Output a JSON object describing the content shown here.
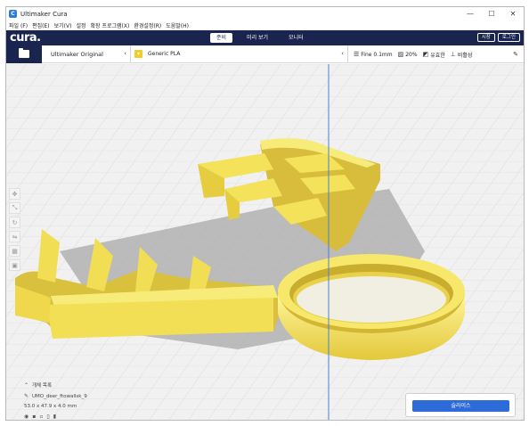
{
  "window": {
    "title": "Ultimaker Cura",
    "app_icon": "cura-app-icon",
    "controls": {
      "minimize": "—",
      "maximize": "☐",
      "close": "✕"
    }
  },
  "menu": [
    "파일 (F)",
    "편집(E)",
    "보기(V)",
    "설정",
    "확장 프로그램(X)",
    "환경설정(R)",
    "도움말(H)"
  ],
  "header": {
    "logo": "cura.",
    "stages": [
      {
        "label": "준비",
        "active": true
      },
      {
        "label": "미리 보기",
        "active": false
      },
      {
        "label": "모니터",
        "active": false
      }
    ],
    "right_buttons": [
      "시장",
      "로그인"
    ]
  },
  "toolbar": {
    "open_icon": "folder-icon",
    "printer": "Ultimaker Original",
    "material": "Generic PLA",
    "settings": {
      "profile": "Fine 0.1mm",
      "infill": "20%",
      "support": "유효한",
      "adhesion": "비활성"
    }
  },
  "left_tools": [
    "move-tool-icon",
    "scale-tool-icon",
    "rotate-tool-icon",
    "mirror-tool-icon",
    "per-model-settings-icon",
    "support-blocker-icon"
  ],
  "object": {
    "list_label": "개체 목록",
    "name": "UMO_deer_ftowallsk_9",
    "dimensions": "53.0 x 47.9 x 4.0 mm"
  },
  "slice": {
    "button": "슬라이스"
  },
  "colors": {
    "header_bg": "#19244f",
    "model_yellow": "#f5e75a",
    "slice_blue": "#2d6bd8",
    "axis_blue": "#4a7fd6"
  }
}
